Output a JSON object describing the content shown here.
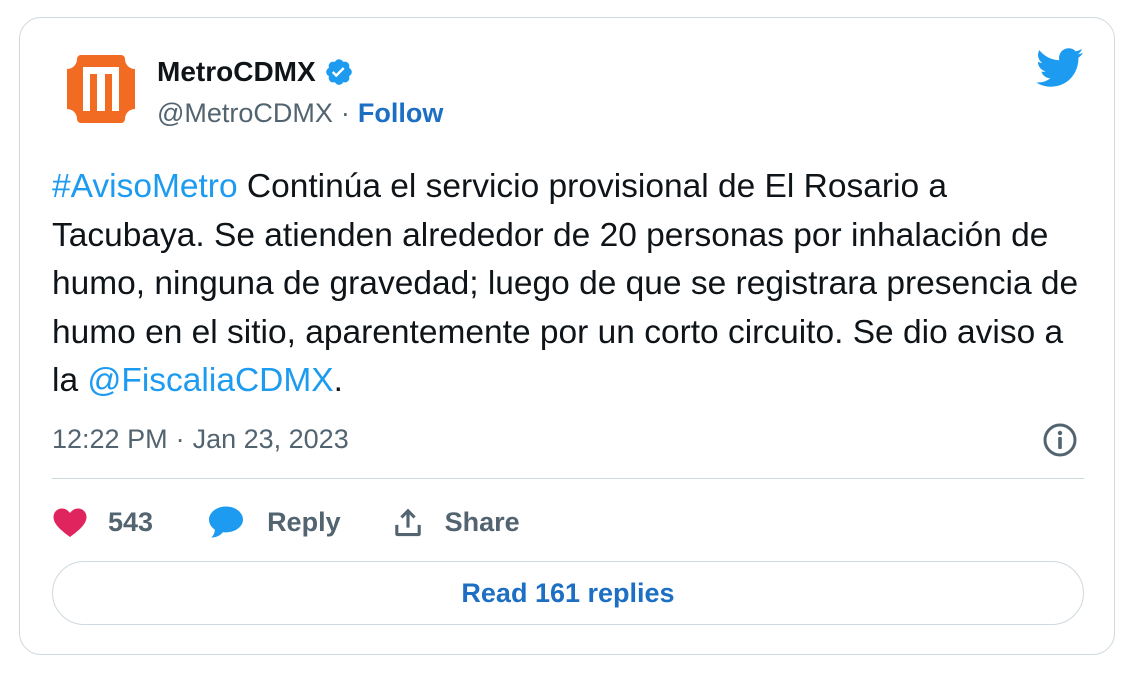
{
  "account": {
    "display_name": "MetroCDMX",
    "handle": "@MetroCDMX",
    "separator": "·",
    "follow_label": "Follow",
    "verified_icon": "verified-badge-icon",
    "avatar_icon": "metro-logo-icon",
    "logo_color": "#f26b22"
  },
  "platform_icon": "twitter-bird-icon",
  "tweet": {
    "hashtag": "#AvisoMetro",
    "text_before_mention": " Continúa el servicio provisional de El Rosario a Tacubaya. Se atienden alrededor de 20 personas por inhalación de humo, ninguna de gravedad; luego de que se registrara presencia de humo en el sitio, aparentemente por un corto circuito. Se dio aviso a la ",
    "mention": "@FiscaliaCDMX",
    "text_after_mention": ".",
    "link_color": "#1d9bf0"
  },
  "meta": {
    "time": "12:22 PM",
    "separator": "·",
    "date": "Jan 23, 2023",
    "info_icon": "info-icon"
  },
  "actions": {
    "like_count": "543",
    "like_icon": "heart-icon",
    "like_color": "#e0245e",
    "reply_label": "Reply",
    "reply_icon": "speech-bubble-icon",
    "reply_color": "#1d9bf0",
    "share_label": "Share",
    "share_icon": "share-upload-icon"
  },
  "read_replies_label": "Read 161 replies"
}
